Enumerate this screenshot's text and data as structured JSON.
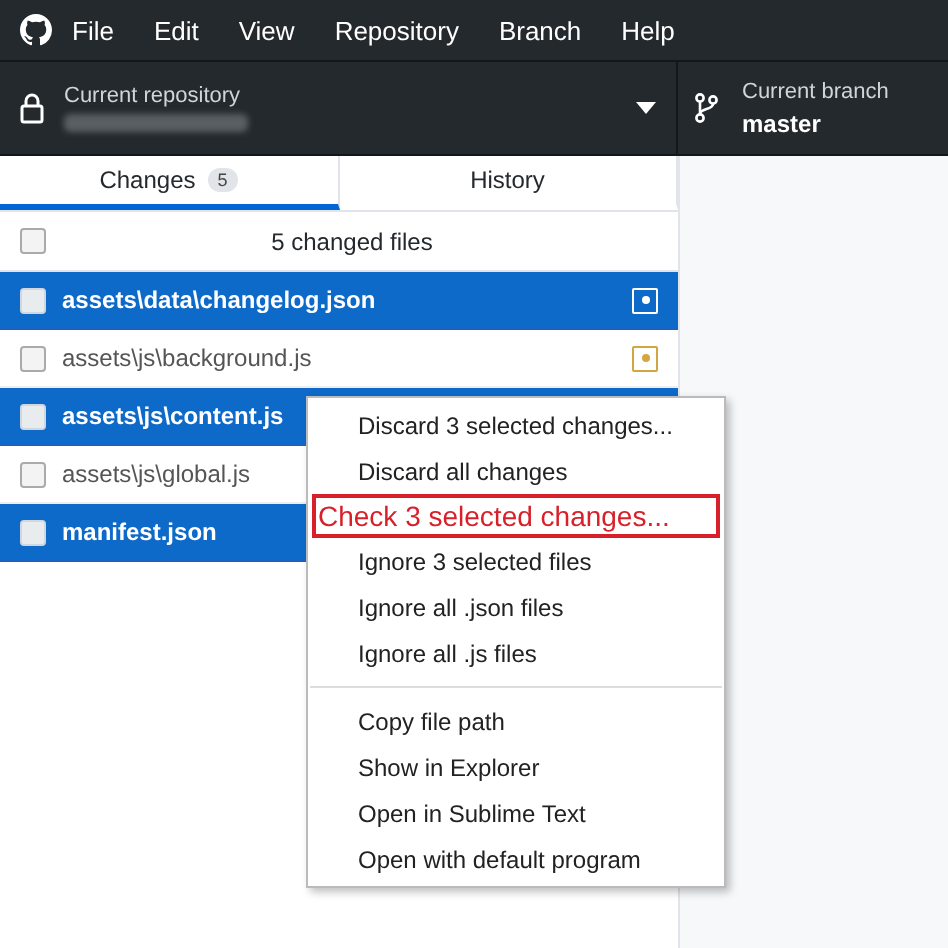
{
  "menu_bar": [
    "File",
    "Edit",
    "View",
    "Repository",
    "Branch",
    "Help"
  ],
  "repository": {
    "label": "Current repository"
  },
  "branch": {
    "label": "Current branch",
    "name": "master"
  },
  "tabs": [
    {
      "label": "Changes",
      "count": "5",
      "selected": true
    },
    {
      "label": "History",
      "selected": false
    }
  ],
  "file_list": {
    "header": "5 changed files",
    "all_checked": false,
    "files": [
      {
        "path": "assets\\data\\changelog.json",
        "selected": true,
        "checked": false,
        "modified": true
      },
      {
        "path": "assets\\js\\background.js",
        "selected": false,
        "checked": false,
        "modified": true
      },
      {
        "path": "assets\\js\\content.js",
        "selected": true,
        "checked": false
      },
      {
        "path": "assets\\js\\global.js",
        "selected": false,
        "checked": false
      },
      {
        "path": "manifest.json",
        "selected": true,
        "checked": false
      }
    ]
  },
  "context_menu": {
    "groups": [
      [
        {
          "label": "Discard 3 selected changes..."
        },
        {
          "label": "Discard all changes"
        },
        {
          "label": "Check 3 selected changes...",
          "highlighted": true
        },
        {
          "label": "Ignore 3 selected files"
        },
        {
          "label": "Ignore all .json files"
        },
        {
          "label": "Ignore all .js files"
        }
      ],
      [
        {
          "label": "Copy file path"
        },
        {
          "label": "Show in Explorer"
        },
        {
          "label": "Open in Sublime Text"
        },
        {
          "label": "Open with default program"
        }
      ]
    ]
  }
}
